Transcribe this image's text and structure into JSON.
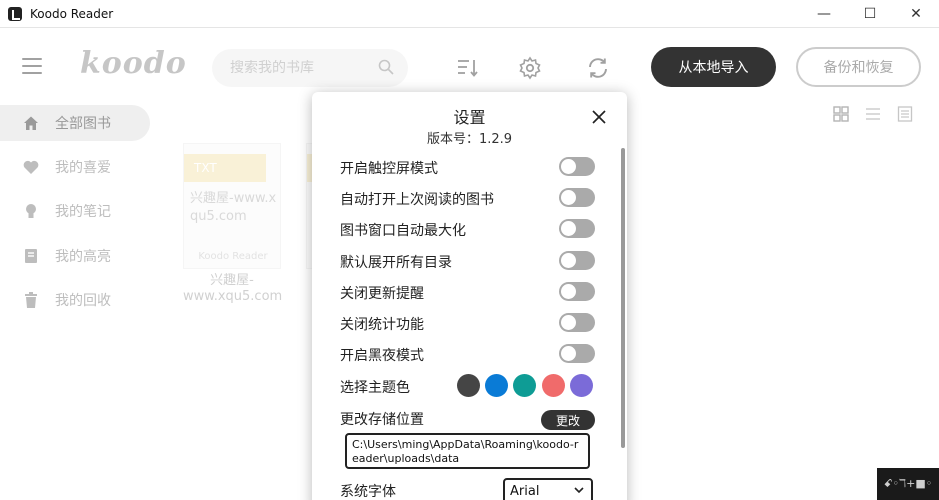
{
  "window": {
    "title": "Koodo Reader",
    "controls": [
      "—",
      "☐",
      "✕"
    ]
  },
  "header": {
    "logo": "koodo",
    "search_placeholder": "搜索我的书库",
    "import_label": "从本地导入",
    "backup_label": "备份和恢复"
  },
  "sidebar": {
    "items": [
      {
        "label": "全部图书",
        "icon": "home-icon"
      },
      {
        "label": "我的喜爱",
        "icon": "heart-icon"
      },
      {
        "label": "我的笔记",
        "icon": "bulb-icon"
      },
      {
        "label": "我的高亮",
        "icon": "highlight-icon"
      },
      {
        "label": "我的回收",
        "icon": "trash-icon"
      }
    ]
  },
  "books": [
    {
      "tag": "TXT",
      "inner_title": "兴趣屋-www.xqu5.com",
      "brand": "Koodo Reader",
      "caption": "兴趣屋-www.xqu5.com"
    }
  ],
  "settings": {
    "title": "设置",
    "version": "版本号：1.2.9",
    "toggles": [
      "开启触控屏模式",
      "自动打开上次阅读的图书",
      "图书窗口自动最大化",
      "默认展开所有目录",
      "关闭更新提醒",
      "关闭统计功能",
      "开启黑夜模式"
    ],
    "theme_label": "选择主题色",
    "theme_colors": [
      "#454545",
      "#0a7bd6",
      "#0e9c95",
      "#f06b6b",
      "#7b6bd8"
    ],
    "storage_label": "更改存储位置",
    "change_label": "更改",
    "storage_path": "C:\\Users\\ming\\AppData\\Roaming\\koodo-reader\\uploads\\data",
    "font_label": "系统字体",
    "font_value": "Arial"
  },
  "watermark": "ꗃ◦ℸ+■◦"
}
